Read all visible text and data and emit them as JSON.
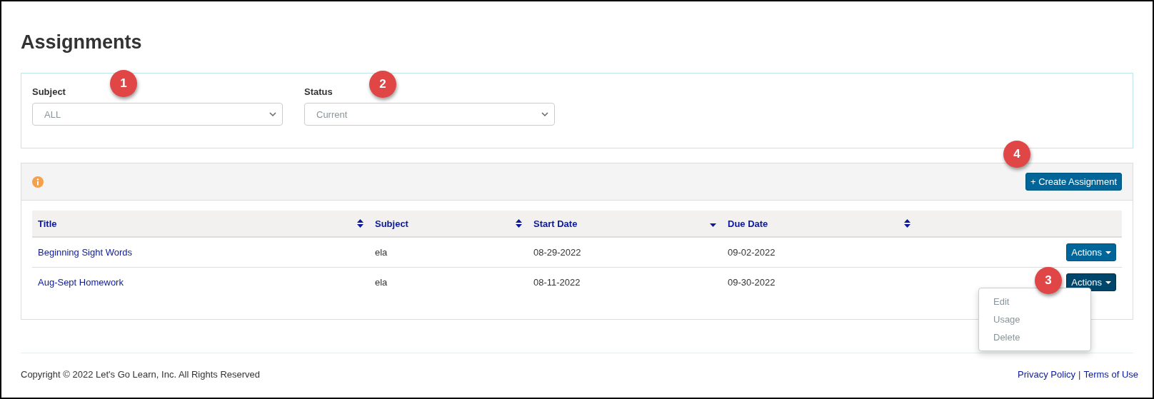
{
  "page": {
    "title": "Assignments"
  },
  "filters": [
    {
      "label": "Subject",
      "value": "ALL"
    },
    {
      "label": "Status",
      "value": "Current"
    }
  ],
  "toolbar": {
    "create_button": "+ Create Assignment"
  },
  "table": {
    "columns": [
      {
        "label": "Title",
        "sorted": false
      },
      {
        "label": "Subject",
        "sorted": false
      },
      {
        "label": "Start Date",
        "sorted": true
      },
      {
        "label": "Due Date",
        "sorted": false
      }
    ],
    "rows": [
      {
        "title": "Beginning Sight Words",
        "subject": "ela",
        "start_date": "08-29-2022",
        "due_date": "09-02-2022",
        "actions": "Actions",
        "expanded": false
      },
      {
        "title": "Aug-Sept Homework",
        "subject": "ela",
        "start_date": "08-11-2022",
        "due_date": "09-30-2022",
        "actions": "Actions",
        "expanded": true
      }
    ]
  },
  "actions_menu": {
    "items": [
      "Edit",
      "Usage",
      "Delete"
    ]
  },
  "callouts": [
    "1",
    "2",
    "3",
    "4"
  ],
  "footer": {
    "copyright": "Copyright © 2022 Let's Go Learn, Inc. All Rights Reserved",
    "links": [
      "Privacy Policy",
      "Terms of Use"
    ],
    "separator": "|"
  }
}
